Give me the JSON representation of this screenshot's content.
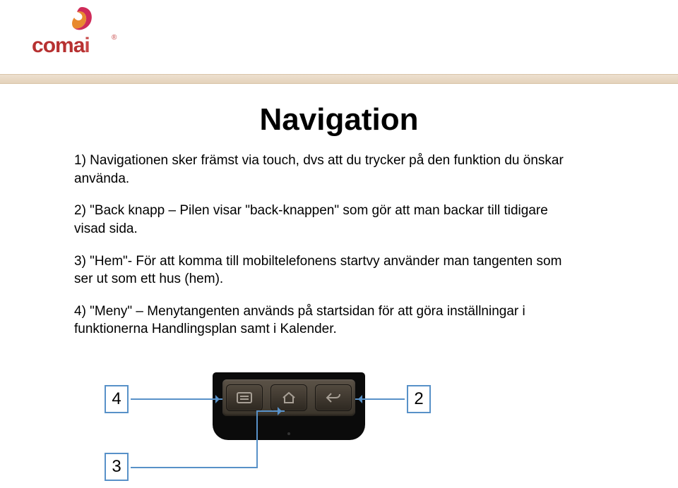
{
  "logo": {
    "text": "comai",
    "trademark": "®"
  },
  "title": "Navigation",
  "paragraphs": {
    "p1": "1) Navigationen sker främst via touch, dvs att du trycker på den funktion du önskar använda.",
    "p2": "2) \"Back knapp – Pilen visar \"back-knappen\" som gör att man backar till tidigare visad sida.",
    "p3": "3) \"Hem\"-  För att komma till mobiltelefonens startvy använder man tangenten som ser ut som ett hus (hem).",
    "p4": "4) \"Meny\" – Menytangenten används på startsidan för att göra inställningar i funktionerna Handlingsplan samt i Kalender."
  },
  "diagram": {
    "label4": "4",
    "label2": "2",
    "label3": "3",
    "phone_buttons": {
      "menu": "menu-icon",
      "home": "home-icon",
      "back": "back-icon"
    }
  }
}
